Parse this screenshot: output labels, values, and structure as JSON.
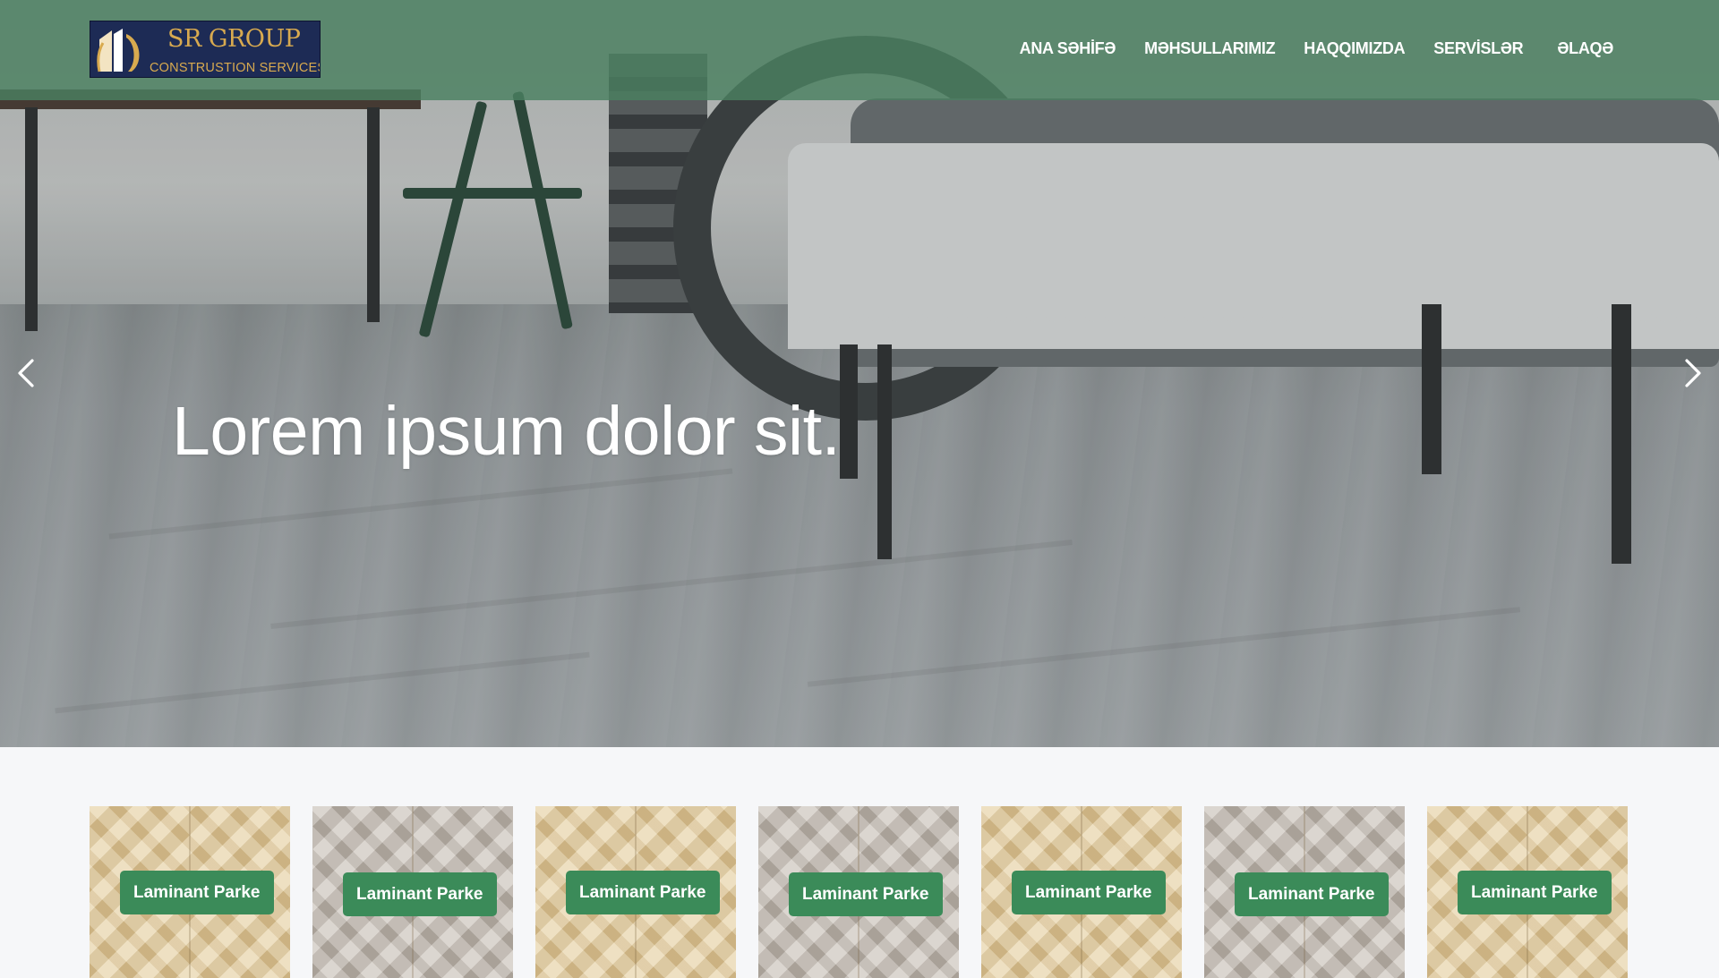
{
  "brand": {
    "title": "SR GROUP",
    "subtitle": "CONSTRUSTION SERVICES",
    "colors": {
      "navy": "#1d2b55",
      "gold": "#d8aa4f"
    }
  },
  "nav": {
    "items": [
      {
        "label": "ANA SƏHİFƏ"
      },
      {
        "label": "MƏHSULLARIMIZ"
      },
      {
        "label": "HAQQIMIZDA"
      },
      {
        "label": "SERVİSLƏR"
      },
      {
        "label": "ƏLAQƏ"
      }
    ],
    "background": "#4b8060"
  },
  "hero": {
    "headline": "Lorem ipsum dolor sit.",
    "prev_icon": "chevron-left-icon",
    "next_icon": "chevron-right-icon"
  },
  "products": {
    "button_color": "#3b8b59",
    "items": [
      {
        "label": "Laminant Parke",
        "tone": "light"
      },
      {
        "label": "Laminant Parke",
        "tone": "grey"
      },
      {
        "label": "Laminant Parke",
        "tone": "light"
      },
      {
        "label": "Laminant Parke",
        "tone": "grey"
      },
      {
        "label": "Laminant Parke",
        "tone": "light"
      },
      {
        "label": "Laminant Parke",
        "tone": "grey"
      },
      {
        "label": "Laminant Parke",
        "tone": "light"
      }
    ]
  }
}
